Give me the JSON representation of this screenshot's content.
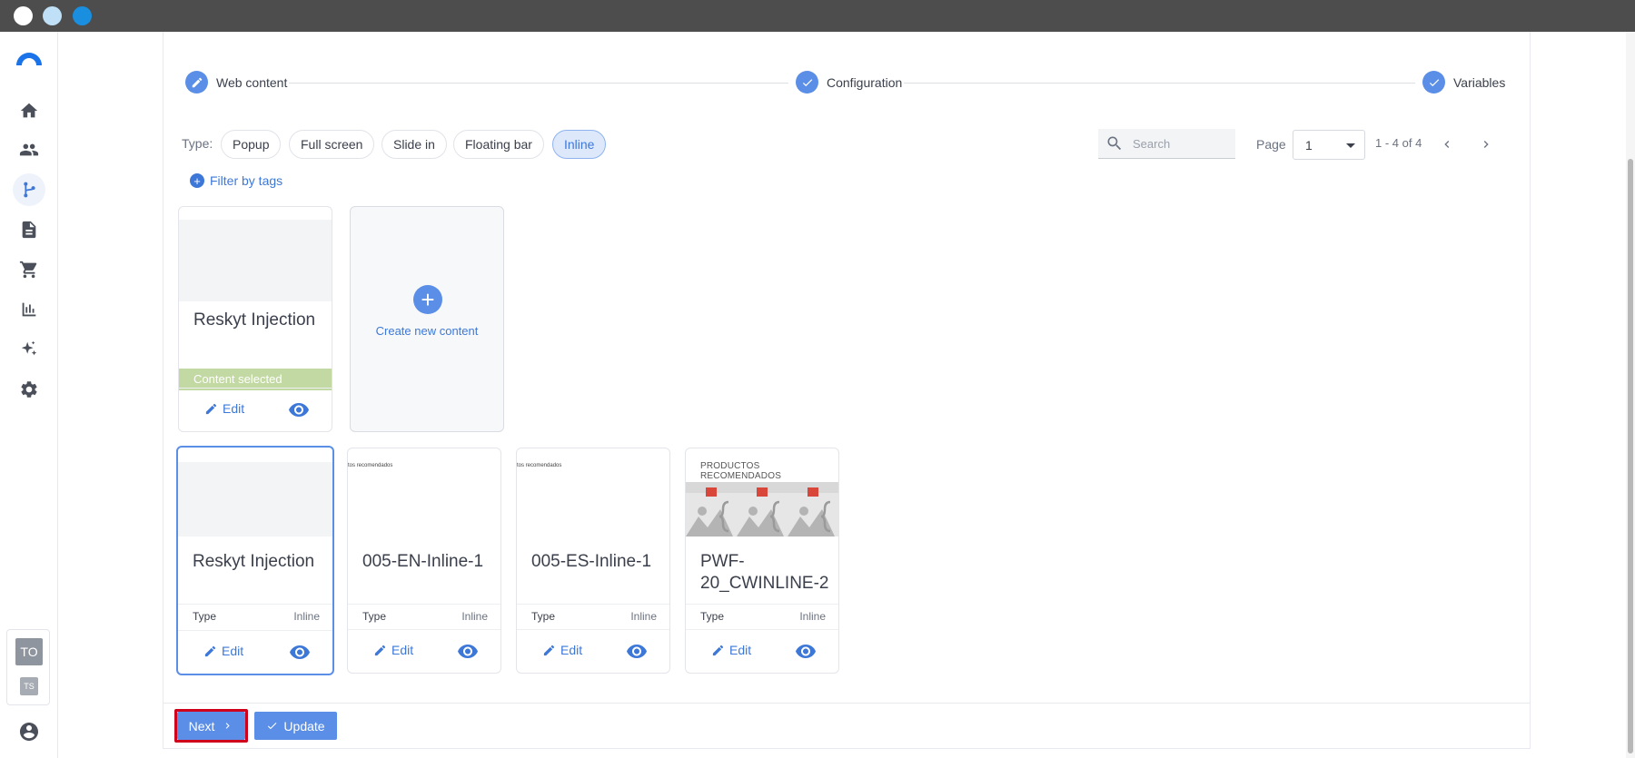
{
  "stepper": {
    "steps": [
      {
        "label": "Web content"
      },
      {
        "label": "Configuration"
      },
      {
        "label": "Variables"
      }
    ]
  },
  "filters": {
    "type_label": "Type:",
    "types": [
      "Popup",
      "Full screen",
      "Slide in",
      "Floating bar",
      "Inline"
    ],
    "selected_type": "Inline",
    "filter_by_tags": "Filter by tags"
  },
  "search": {
    "placeholder": "Search"
  },
  "paging": {
    "page_label": "Page",
    "current_page": "1",
    "range": "1 - 4 of 4"
  },
  "selected_card": {
    "title": "Reskyt Injection",
    "status": "Content selected",
    "edit_label": "Edit"
  },
  "create": {
    "label": "Create new content"
  },
  "cards": [
    {
      "title": "Reskyt Injection",
      "type_label": "Type",
      "type_value": "Inline",
      "edit_label": "Edit",
      "header_text": ""
    },
    {
      "title": "005-EN-Inline-1",
      "type_label": "Type",
      "type_value": "Inline",
      "edit_label": "Edit",
      "header_text": "tos recomendados"
    },
    {
      "title": "005-ES-Inline-1",
      "type_label": "Type",
      "type_value": "Inline",
      "edit_label": "Edit",
      "header_text": "tos recomendados"
    },
    {
      "title": "PWF-20_CWINLINE-2",
      "type_label": "Type",
      "type_value": "Inline",
      "edit_label": "Edit",
      "header_text": "PRODUCTOS RECOMENDADOS"
    }
  ],
  "workspace": {
    "primary": "TO",
    "secondary": "TS"
  },
  "footer": {
    "next_label": "Next",
    "update_label": "Update"
  },
  "colors": {
    "accent": "#5b8ee6",
    "link": "#3d78d8",
    "selected_band": "#c3d9a3",
    "highlight_outline": "#d0021b"
  }
}
